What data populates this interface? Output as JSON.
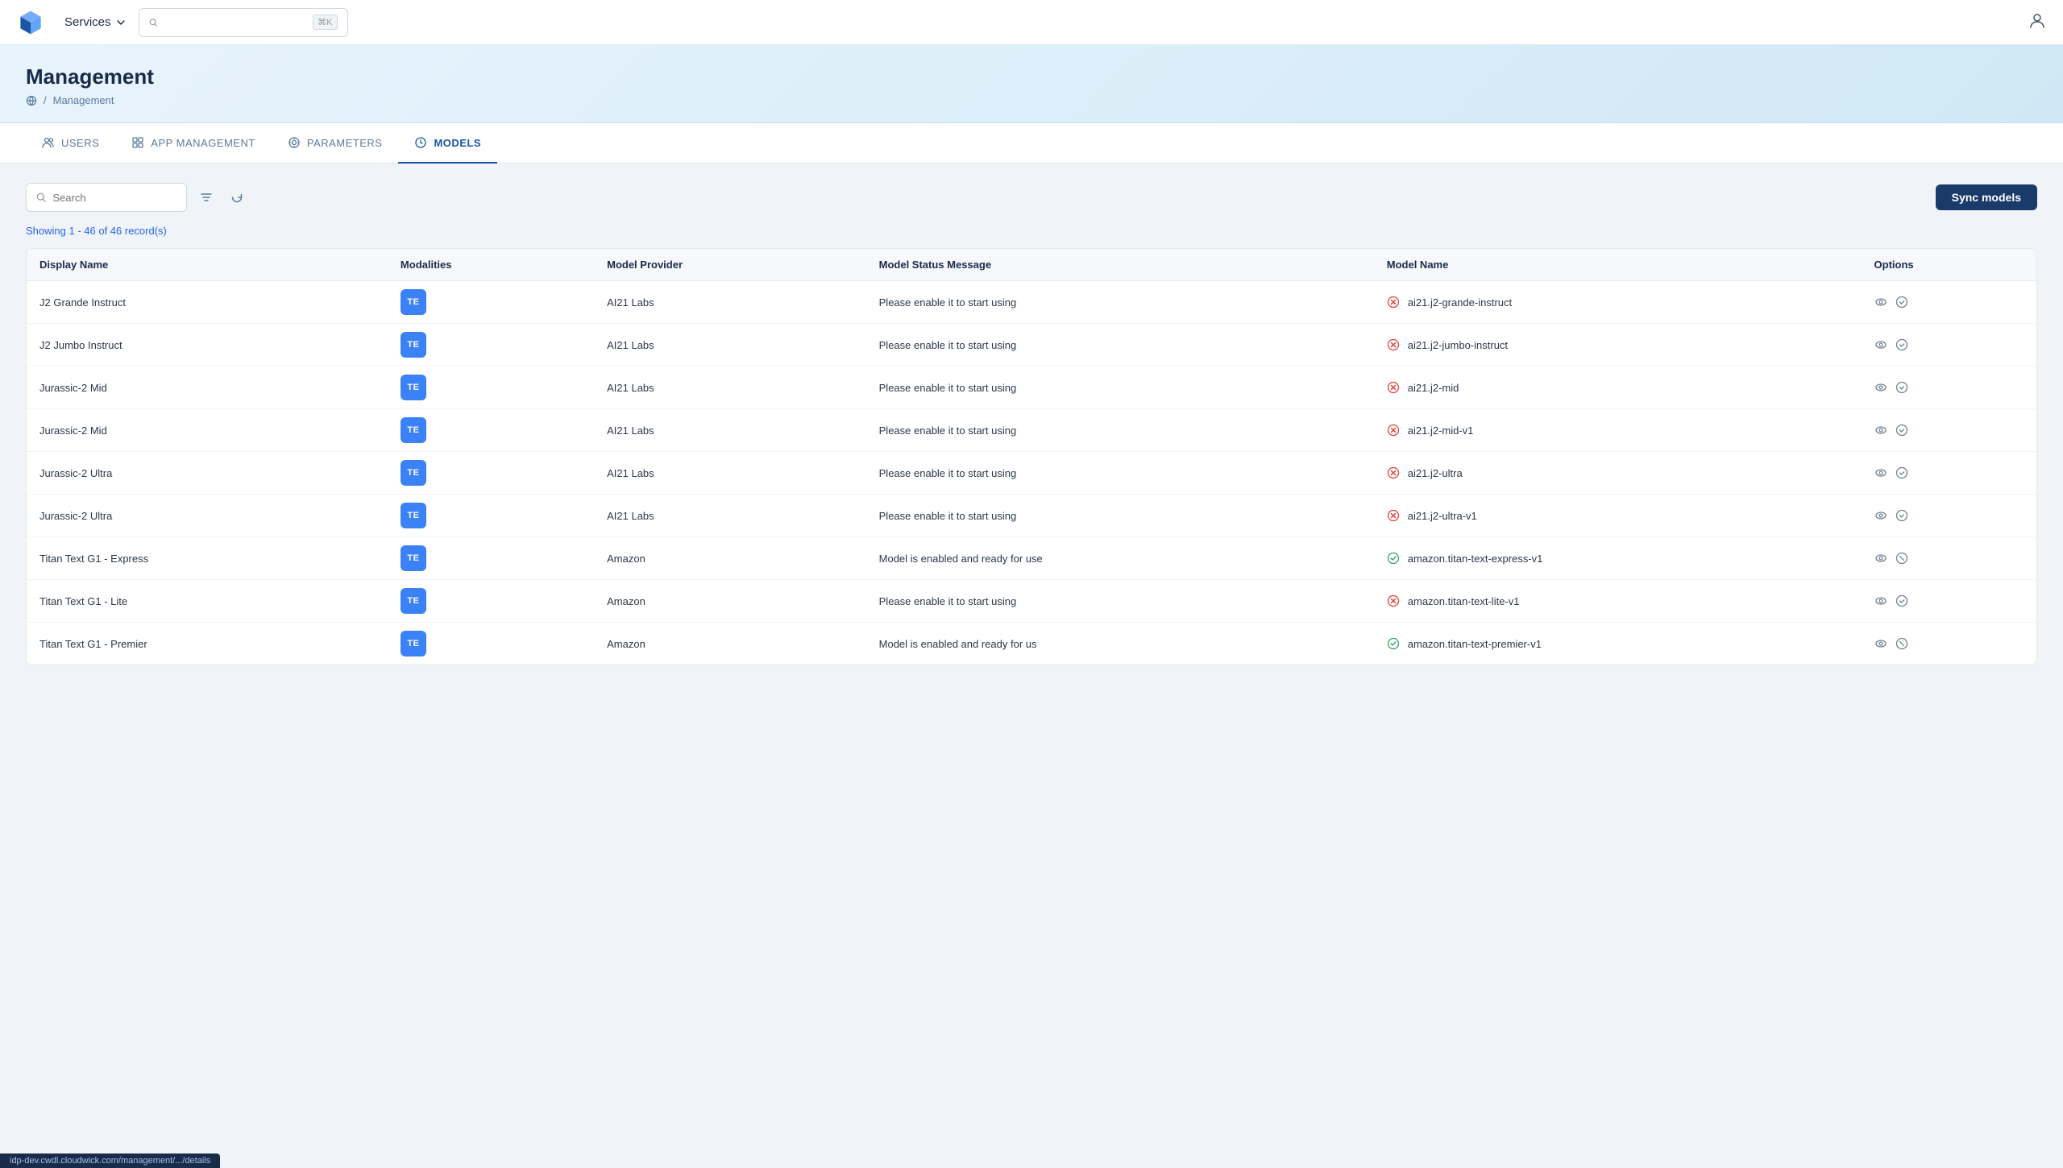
{
  "nav": {
    "services_label": "Services",
    "search_placeholder": "⌘K",
    "search_shortcut": "⌘K"
  },
  "page": {
    "title": "Management",
    "breadcrumb_home": "🌐",
    "breadcrumb_current": "Management"
  },
  "tabs": [
    {
      "id": "users",
      "label": "USERS",
      "active": false
    },
    {
      "id": "app-management",
      "label": "APP MANAGEMENT",
      "active": false
    },
    {
      "id": "parameters",
      "label": "PARAMETERS",
      "active": false
    },
    {
      "id": "models",
      "label": "MODELS",
      "active": true
    }
  ],
  "toolbar": {
    "search_placeholder": "Search",
    "sync_label": "Sync models"
  },
  "records": {
    "count_text": "Showing 1 - 46 of 46 record(s)"
  },
  "table": {
    "columns": [
      "Display Name",
      "Modalities",
      "Model Provider",
      "Model Status Message",
      "Model Name",
      "Options"
    ],
    "rows": [
      {
        "display_name": "J2 Grande Instruct",
        "modality": "TE",
        "provider": "AI21 Labs",
        "status_msg": "Please enable it to start using",
        "status_type": "x",
        "model_name": "ai21.j2-grande-instruct"
      },
      {
        "display_name": "J2 Jumbo Instruct",
        "modality": "TE",
        "provider": "AI21 Labs",
        "status_msg": "Please enable it to start using",
        "status_type": "x",
        "model_name": "ai21.j2-jumbo-instruct"
      },
      {
        "display_name": "Jurassic-2 Mid",
        "modality": "TE",
        "provider": "AI21 Labs",
        "status_msg": "Please enable it to start using",
        "status_type": "x",
        "model_name": "ai21.j2-mid"
      },
      {
        "display_name": "Jurassic-2 Mid",
        "modality": "TE",
        "provider": "AI21 Labs",
        "status_msg": "Please enable it to start using",
        "status_type": "x",
        "model_name": "ai21.j2-mid-v1"
      },
      {
        "display_name": "Jurassic-2 Ultra",
        "modality": "TE",
        "provider": "AI21 Labs",
        "status_msg": "Please enable it to start using",
        "status_type": "x",
        "model_name": "ai21.j2-ultra"
      },
      {
        "display_name": "Jurassic-2 Ultra",
        "modality": "TE",
        "provider": "AI21 Labs",
        "status_msg": "Please enable it to start using",
        "status_type": "x",
        "model_name": "ai21.j2-ultra-v1"
      },
      {
        "display_name": "Titan Text G1 - Express",
        "modality": "TE",
        "provider": "Amazon",
        "status_msg": "Model is enabled and ready for use",
        "status_type": "check",
        "model_name": "amazon.titan-text-express-v1"
      },
      {
        "display_name": "Titan Text G1 - Lite",
        "modality": "TE",
        "provider": "Amazon",
        "status_msg": "Please enable it to start using",
        "status_type": "x",
        "model_name": "amazon.titan-text-lite-v1"
      },
      {
        "display_name": "Titan Text G1 - Premier",
        "modality": "TE",
        "provider": "Amazon",
        "status_msg": "Model is enabled and ready for us",
        "status_type": "check",
        "model_name": "amazon.titan-text-premier-v1"
      }
    ]
  },
  "status_bar": {
    "url": "idp-dev.cwdl.cloudwick.com/management/.../details"
  }
}
